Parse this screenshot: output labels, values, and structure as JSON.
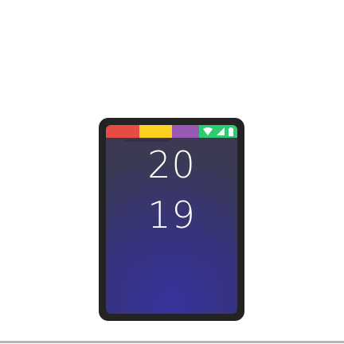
{
  "device": {
    "year_top": "20",
    "year_bottom": "19"
  },
  "status_bar": {
    "colors": [
      "#e74c43",
      "#fdd21f",
      "#9b59b6",
      "#2ecc71"
    ],
    "icons": [
      "wifi-icon",
      "signal-icon",
      "battery-icon"
    ]
  },
  "colors": {
    "screen_top": "#3b3a52",
    "screen_bottom": "#37339c",
    "frame": "#232325"
  }
}
